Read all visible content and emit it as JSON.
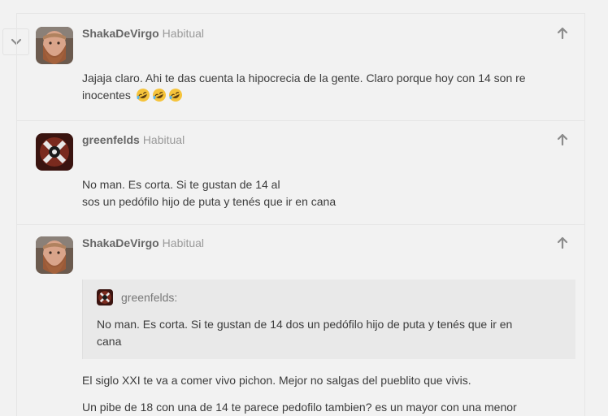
{
  "posts": [
    {
      "author": "ShakaDeVirgo",
      "badge": "Habitual",
      "lines": [
        "Jajaja claro. Ahi te das cuenta la hipocrecia de la gente. Claro porque hoy con 14 son re",
        "inocentes"
      ],
      "emoji_count": 3
    },
    {
      "author": "greenfelds",
      "badge": "Habitual",
      "lines": [
        "No man. Es corta. Si te gustan de 14 al",
        "sos un pedófilo hijo de puta y tenés que ir en cana"
      ]
    },
    {
      "author": "ShakaDeVirgo",
      "badge": "Habitual",
      "quote": {
        "author": "greenfelds:",
        "lines": [
          "No man. Es corta. Si te gustan de 14 dos un pedófilo hijo de puta y tenés que ir en",
          "cana"
        ]
      },
      "paragraphs": [
        "El siglo XXI te va a comer vivo pichon. Mejor no salgas del pueblito que vivis.",
        "Un pibe de 18 con una de 14 te parece pedofilo tambien? es un mayor con una menor"
      ]
    }
  ],
  "icons": {
    "collapse": "chevron-down-icon",
    "vote": "arrow-up-icon",
    "emoji": "rofl-emoji-icon"
  },
  "colors": {
    "background": "#f2f2f2",
    "quote_bg": "#e9e9e9",
    "emoji": "#f5c33b"
  }
}
